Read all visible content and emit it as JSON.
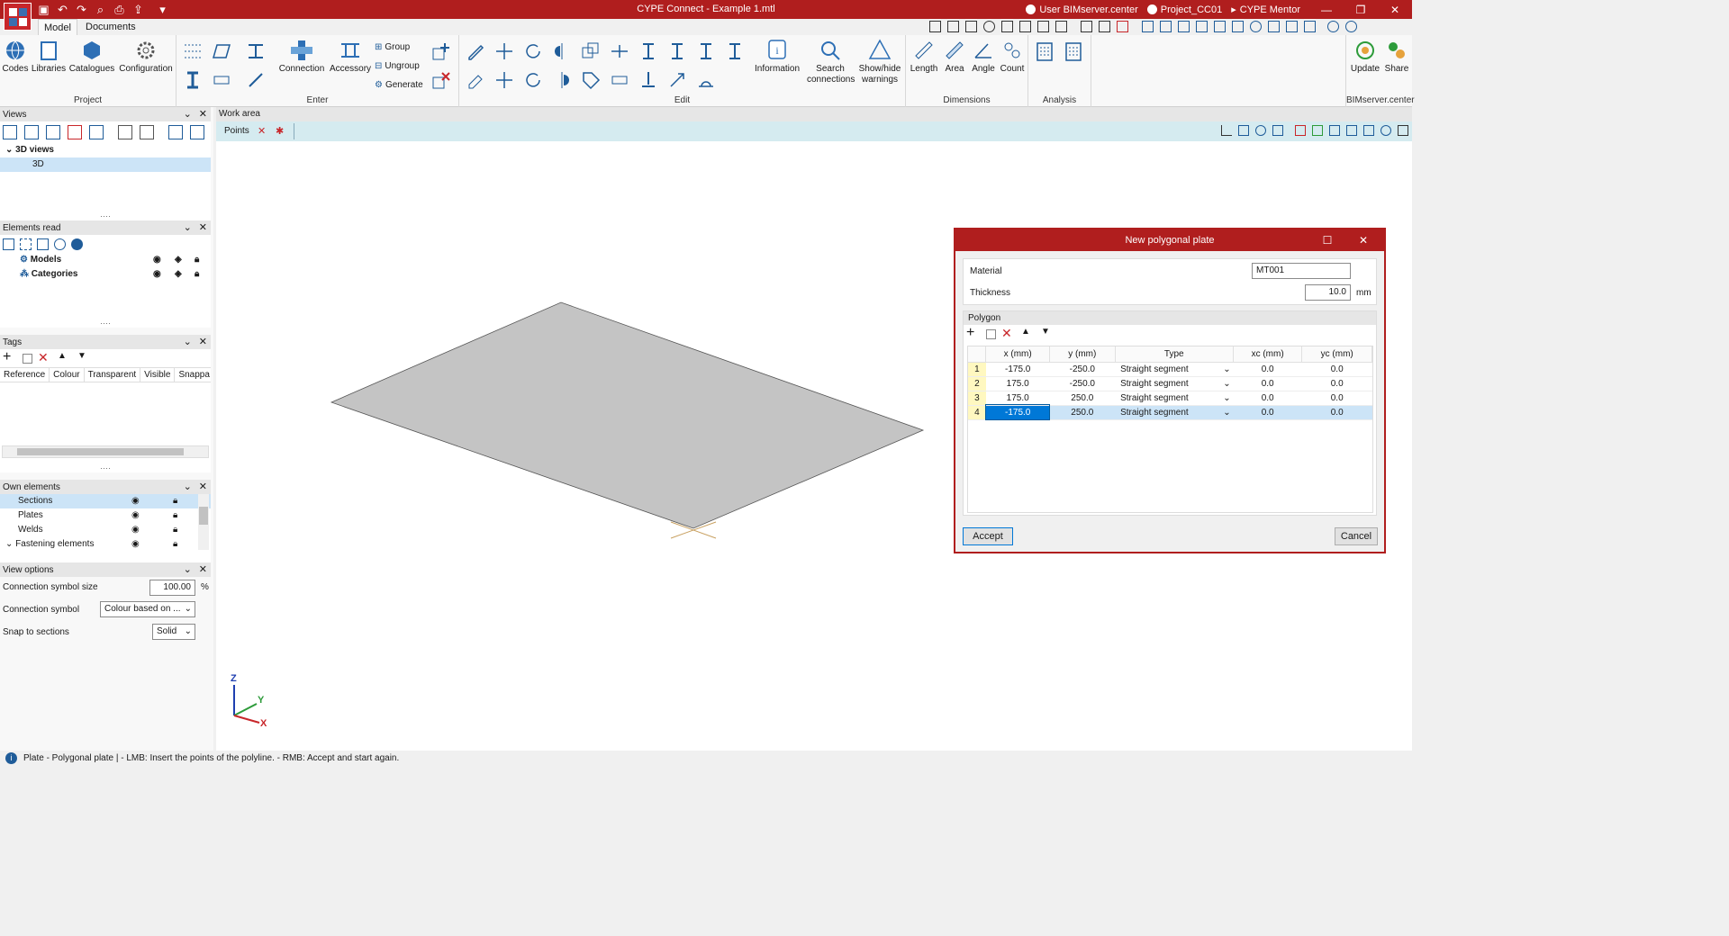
{
  "app": {
    "title": "CYPE Connect - Example 1.mtl"
  },
  "titlebar_right": {
    "user": "User BIMserver.center",
    "project": "Project_CC01",
    "mentor": "CYPE Mentor"
  },
  "tabs": [
    {
      "label": "Model"
    },
    {
      "label": "Documents"
    }
  ],
  "ribbon": {
    "project": {
      "label": "Project",
      "codes": "Codes",
      "libraries": "Libraries",
      "catalogues": "Catalogues",
      "configuration": "Configuration"
    },
    "enter": {
      "label": "Enter",
      "connection": "Connection",
      "accessory": "Accessory",
      "group": "Group",
      "ungroup": "Ungroup",
      "generate": "Generate"
    },
    "edit": {
      "label": "Edit",
      "information": "Information",
      "search": "Search connections",
      "showhide": "Show/hide warnings"
    },
    "dimensions": {
      "label": "Dimensions",
      "length": "Length",
      "area": "Area",
      "angle": "Angle",
      "count": "Count"
    },
    "analysis": {
      "label": "Analysis"
    },
    "bim": {
      "label": "BIMserver.center",
      "update": "Update",
      "share": "Share"
    }
  },
  "views": {
    "title": "Views",
    "group": "3D views",
    "item": "3D"
  },
  "elements_read": {
    "title": "Elements read",
    "items": [
      "Models",
      "Categories"
    ]
  },
  "tags": {
    "title": "Tags",
    "columns": [
      "Reference",
      "Colour",
      "Transparent",
      "Visible",
      "Snappa"
    ]
  },
  "own_elements": {
    "title": "Own elements",
    "items": [
      "Sections",
      "Plates",
      "Welds",
      "Fastening elements"
    ]
  },
  "view_options": {
    "title": "View options",
    "symbol_size_label": "Connection symbol size",
    "symbol_size_value": "100.00",
    "symbol_size_unit": "%",
    "symbol_label": "Connection symbol",
    "symbol_value": "Colour based on ...",
    "snap_label": "Snap to sections",
    "snap_value": "Solid"
  },
  "workarea": {
    "title": "Work area",
    "toolbar_label": "Points"
  },
  "axes": {
    "z": "Z",
    "y": "Y",
    "x": "X"
  },
  "dialog": {
    "title": "New polygonal plate",
    "material_label": "Material",
    "material_value": "MT001",
    "thickness_label": "Thickness",
    "thickness_value": "10.0",
    "thickness_unit": "mm",
    "polygon_label": "Polygon",
    "columns": [
      "",
      "x (mm)",
      "y (mm)",
      "Type",
      "",
      "xc (mm)",
      "yc (mm)"
    ],
    "rows": [
      {
        "n": "1",
        "x": "-175.0",
        "y": "-250.0",
        "type": "Straight segment",
        "xc": "0.0",
        "yc": "0.0"
      },
      {
        "n": "2",
        "x": "175.0",
        "y": "-250.0",
        "type": "Straight segment",
        "xc": "0.0",
        "yc": "0.0"
      },
      {
        "n": "3",
        "x": "175.0",
        "y": "250.0",
        "type": "Straight segment",
        "xc": "0.0",
        "yc": "0.0"
      },
      {
        "n": "4",
        "x": "-175.0",
        "y": "250.0",
        "type": "Straight segment",
        "xc": "0.0",
        "yc": "0.0"
      }
    ],
    "accept": "Accept",
    "cancel": "Cancel"
  },
  "status": {
    "text": "Plate - Polygonal plate  |  - LMB: Insert the points of the polyline. - RMB: Accept and start again."
  },
  "colors": {
    "brand": "#b01e1e",
    "icon": "#1f5c99",
    "selection": "#cce4f7",
    "plate": "#c4c4c4"
  }
}
